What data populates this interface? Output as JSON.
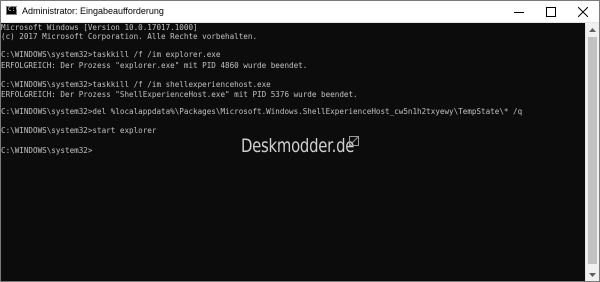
{
  "window": {
    "title": "Administrator: Eingabeaufforderung",
    "icon": "cmd-icon",
    "icon_prompt": "C:\\",
    "controls": [
      "minimize-icon",
      "maximize-icon",
      "close-icon"
    ]
  },
  "console": {
    "background": "#0c0c0c",
    "text_color": "#c0c0c0",
    "lines": [
      "Microsoft Windows [Version 10.0.17017.1000]",
      "(c) 2017 Microsoft Corporation. Alle Rechte vorbehalten.",
      "",
      "C:\\WINDOWS\\system32>taskkill /f /im explorer.exe",
      "ERFOLGREICH: Der Prozess \"explorer.exe\" mit PID 4860 wurde beendet.",
      "",
      "C:\\WINDOWS\\system32>taskkill /f /im shellexperiencehost.exe",
      "ERFOLGREICH: Der Prozess \"ShellExperienceHost.exe\" mit PID 5376 wurde beendet.",
      "",
      "C:\\WINDOWS\\system32>del %localappdata%\\Packages\\Microsoft.Windows.ShellExperienceHost_cw5n1h2txyewy\\TempState\\* /q",
      "",
      "C:\\WINDOWS\\system32>start explorer",
      "",
      "C:\\WINDOWS\\system32>"
    ]
  },
  "watermark": {
    "text": "Deskmodder.de"
  },
  "scrollbar": {
    "up_icon": "scroll-up-arrow-icon",
    "down_icon": "scroll-down-arrow-icon"
  }
}
